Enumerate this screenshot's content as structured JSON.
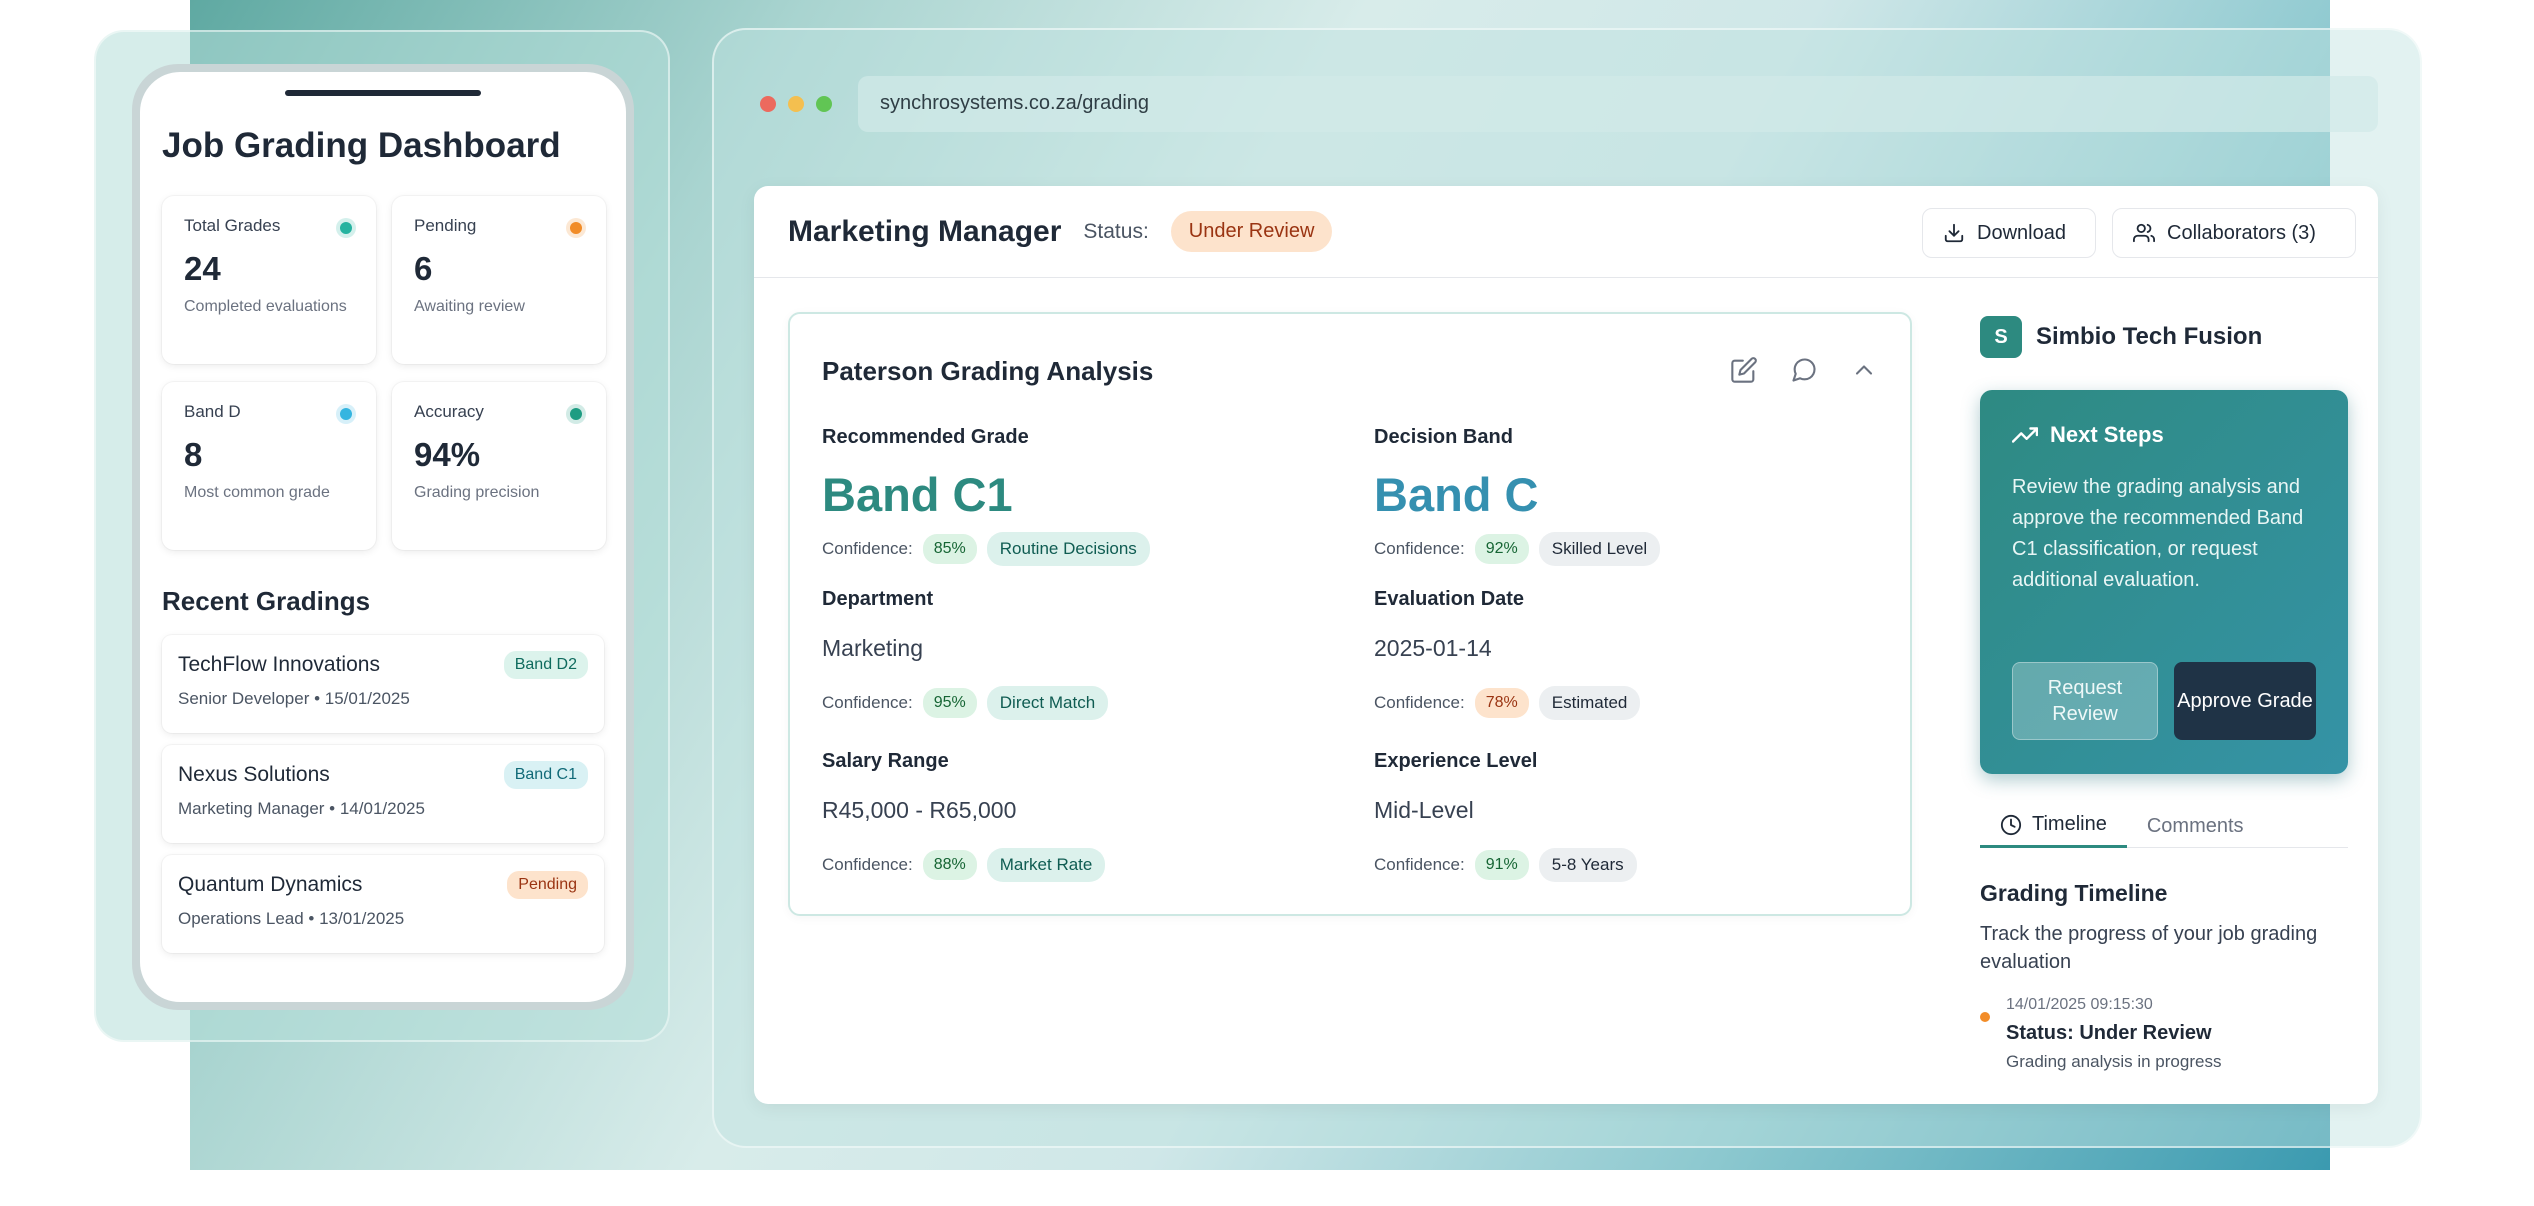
{
  "colors": {
    "accent": "#2d8a80",
    "band_c1": "#2d8a80",
    "band_c": "#3590b0",
    "pending": "#f28c28",
    "window_red": "#ec6a5e",
    "window_yellow": "#f4bf4f",
    "window_green": "#61c554"
  },
  "phone": {
    "title": "Job Grading Dashboard",
    "stats": [
      {
        "label": "Total Grades",
        "value": "24",
        "sub": "Completed evaluations",
        "dot": "#26b3a0"
      },
      {
        "label": "Pending",
        "value": "6",
        "sub": "Awaiting review",
        "dot": "#f28c28"
      },
      {
        "label": "Band D",
        "value": "8",
        "sub": "Most common grade",
        "dot": "#35b6e0"
      },
      {
        "label": "Accuracy",
        "value": "94%",
        "sub": "Grading precision",
        "dot": "#1f9d82"
      }
    ],
    "recent_title": "Recent Gradings",
    "recent": [
      {
        "company": "TechFlow Innovations",
        "meta": "Senior Developer • 15/01/2025",
        "badge": "Band D2",
        "badge_kind": "teal"
      },
      {
        "company": "Nexus Solutions",
        "meta": "Marketing Manager • 14/01/2025",
        "badge": "Band C1",
        "badge_kind": "cyan"
      },
      {
        "company": "Quantum Dynamics",
        "meta": "Operations Lead • 13/01/2025",
        "badge": "Pending",
        "badge_kind": "orange"
      }
    ]
  },
  "browser": {
    "url": "synchrosystems.co.za/grading"
  },
  "header": {
    "job_title": "Marketing Manager",
    "status_label": "Status:",
    "status_value": "Under Review",
    "download_label": "Download",
    "collaborators_label": "Collaborators (3)"
  },
  "analysis": {
    "title": "Paterson Grading Analysis",
    "confidence_label": "Confidence:",
    "recommended_grade": {
      "label": "Recommended Grade",
      "value": "Band C1",
      "confidence": "85%",
      "tag": "Routine Decisions"
    },
    "decision_band": {
      "label": "Decision Band",
      "value": "Band C",
      "confidence": "92%",
      "tag": "Skilled Level"
    },
    "department": {
      "label": "Department",
      "value": "Marketing",
      "confidence": "95%",
      "tag": "Direct Match"
    },
    "evaluation_date": {
      "label": "Evaluation Date",
      "value": "2025-01-14",
      "confidence": "78%",
      "tag": "Estimated"
    },
    "salary_range": {
      "label": "Salary Range",
      "value": "R45,000 - R65,000",
      "confidence": "88%",
      "tag": "Market Rate"
    },
    "experience_level": {
      "label": "Experience Level",
      "value": "Mid-Level",
      "confidence": "91%",
      "tag": "5-8 Years"
    }
  },
  "sidebar": {
    "company_initial": "S",
    "company_name": "Simbio Tech Fusion",
    "next_steps": {
      "title": "Next Steps",
      "text": "Review the grading analysis and approve the recommended Band C1 classification, or request additional evaluation.",
      "request_label": "Request Review",
      "approve_label": "Approve Grade"
    },
    "tabs": [
      "Timeline",
      "Comments"
    ],
    "timeline_title": "Grading Timeline",
    "timeline_desc": "Track the progress of your job grading evaluation",
    "events": [
      {
        "time": "14/01/2025 09:15:30",
        "status": "Status: Under Review",
        "note": "Grading analysis in progress"
      }
    ]
  }
}
